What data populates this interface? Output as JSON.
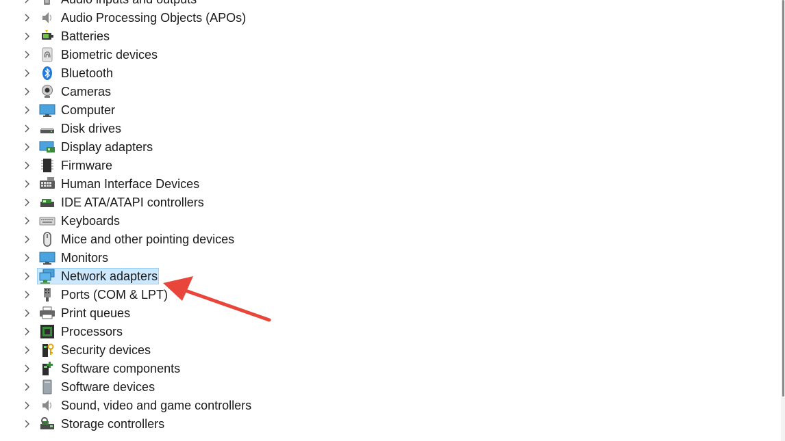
{
  "tree": {
    "items": [
      {
        "label": "Audio inputs and outputs",
        "icon": "speaker-icon"
      },
      {
        "label": "Audio Processing Objects (APOs)",
        "icon": "speaker-icon"
      },
      {
        "label": "Batteries",
        "icon": "battery-icon"
      },
      {
        "label": "Biometric devices",
        "icon": "fingerprint-icon"
      },
      {
        "label": "Bluetooth",
        "icon": "bluetooth-icon"
      },
      {
        "label": "Cameras",
        "icon": "webcam-icon"
      },
      {
        "label": "Computer",
        "icon": "monitor-icon"
      },
      {
        "label": "Disk drives",
        "icon": "disk-drive-icon"
      },
      {
        "label": "Display adapters",
        "icon": "display-adapter-icon"
      },
      {
        "label": "Firmware",
        "icon": "chip-icon"
      },
      {
        "label": "Human Interface Devices",
        "icon": "hid-icon"
      },
      {
        "label": "IDE ATA/ATAPI controllers",
        "icon": "ide-controller-icon"
      },
      {
        "label": "Keyboards",
        "icon": "keyboard-icon"
      },
      {
        "label": "Mice and other pointing devices",
        "icon": "mouse-icon"
      },
      {
        "label": "Monitors",
        "icon": "monitor-icon"
      },
      {
        "label": "Network adapters",
        "icon": "network-adapter-icon",
        "selected": true
      },
      {
        "label": "Ports (COM & LPT)",
        "icon": "port-icon"
      },
      {
        "label": "Print queues",
        "icon": "printer-icon"
      },
      {
        "label": "Processors",
        "icon": "processor-icon"
      },
      {
        "label": "Security devices",
        "icon": "security-key-icon"
      },
      {
        "label": "Software components",
        "icon": "software-component-icon"
      },
      {
        "label": "Software devices",
        "icon": "software-device-icon"
      },
      {
        "label": "Sound, video and game controllers",
        "icon": "speaker-icon"
      },
      {
        "label": "Storage controllers",
        "icon": "storage-controller-icon"
      }
    ]
  },
  "colors": {
    "selection_bg": "#cce8ff",
    "selection_border": "#99d1ff",
    "arrow": "#e8463a",
    "text": "#1a1a1a"
  }
}
